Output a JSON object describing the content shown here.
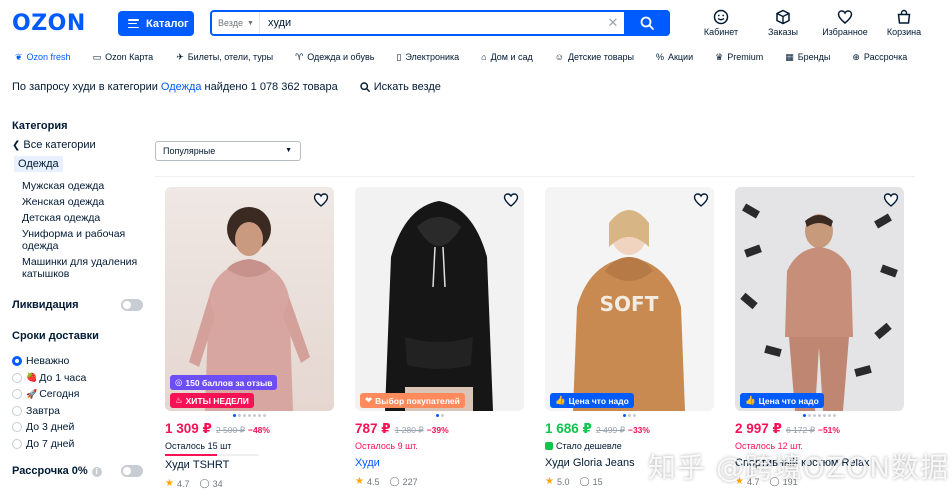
{
  "header": {
    "logo": "OZON",
    "catalog_label": "Каталог",
    "search_scope": "Везде",
    "search_value": "худи",
    "icons": [
      {
        "label": "Кабинет",
        "icon": "smile-icon"
      },
      {
        "label": "Заказы",
        "icon": "box-icon"
      },
      {
        "label": "Избранное",
        "icon": "heart-icon"
      },
      {
        "label": "Корзина",
        "icon": "bag-icon"
      }
    ]
  },
  "nav": [
    {
      "label": "Ozon fresh",
      "icon": "leaf-icon"
    },
    {
      "label": "Ozon Карта",
      "icon": "card-icon"
    },
    {
      "label": "Билеты, отели, туры",
      "icon": "plane-icon"
    },
    {
      "label": "Одежда и обувь",
      "icon": "shirt-icon"
    },
    {
      "label": "Электроника",
      "icon": "phone-icon"
    },
    {
      "label": "Дом и сад",
      "icon": "home-icon"
    },
    {
      "label": "Детские товары",
      "icon": "baby-icon"
    },
    {
      "label": "Акции",
      "icon": "percent-icon"
    },
    {
      "label": "Premium",
      "icon": "crown-icon"
    },
    {
      "label": "Бренды",
      "icon": "brand-icon"
    },
    {
      "label": "Рассрочка",
      "icon": "installment-icon"
    }
  ],
  "query": {
    "prefix": "По запросу худи в категории",
    "category": "Одежда",
    "suffix": "найдено 1 078 362 товара",
    "search_all": "Искать везде"
  },
  "sidebar": {
    "category_title": "Категория",
    "back_label": "Все категории",
    "current": "Одежда",
    "subcategories": [
      "Мужская одежда",
      "Женская одежда",
      "Детская одежда",
      "Униформа и рабочая одежда",
      "Машинки для удаления катышков"
    ],
    "liquidation_label": "Ликвидация",
    "delivery_title": "Сроки доставки",
    "delivery_options": [
      {
        "label": "Неважно",
        "selected": true,
        "emoji": ""
      },
      {
        "label": "До 1 часа",
        "selected": false,
        "emoji": "🍓"
      },
      {
        "label": "Сегодня",
        "selected": false,
        "emoji": "🚀"
      },
      {
        "label": "Завтра",
        "selected": false,
        "emoji": ""
      },
      {
        "label": "До 3 дней",
        "selected": false,
        "emoji": ""
      },
      {
        "label": "До 7 дней",
        "selected": false,
        "emoji": ""
      }
    ],
    "installment_label": "Рассрочка 0%"
  },
  "sort": {
    "selected": "Популярные"
  },
  "products": [
    {
      "price": "1 309 ₽",
      "old_price": "2 500 ₽",
      "discount": "−48%",
      "stock": "Осталось 15 шт",
      "stock_level": 0.55,
      "name": "Худи TSHRT",
      "name_link": false,
      "rating": "4.7",
      "reviews": "34",
      "badges": [
        {
          "text": "150 баллов за отзыв",
          "color": "#6c4df6"
        },
        {
          "text": "ХИТЫ НЕДЕЛИ",
          "color": "#f91155"
        }
      ],
      "note": ""
    },
    {
      "price": "787 ₽",
      "old_price": "1 280 ₽",
      "discount": "−39%",
      "stock": "Осталось 9 шт.",
      "stock_level": 0,
      "name": "Худи",
      "name_link": true,
      "rating": "4.5",
      "reviews": "227",
      "badges": [
        {
          "text": "Выбор покупателей",
          "color": "#ff8a5c"
        }
      ],
      "note": ""
    },
    {
      "price": "1 686 ₽",
      "old_price": "2 499 ₽",
      "discount": "−33%",
      "stock": "",
      "stock_level": 0,
      "name": "Худи Gloria Jeans",
      "name_link": false,
      "rating": "5.0",
      "reviews": "15",
      "badges": [
        {
          "text": "Цена что надо",
          "color": "#005bff"
        }
      ],
      "note": "Стало дешевле"
    },
    {
      "price": "2 997 ₽",
      "old_price": "6 172 ₽",
      "discount": "−51%",
      "stock": "Осталось 12 шт.",
      "stock_level": 0,
      "name": "Спортивный костюм Relax",
      "name_link": false,
      "rating": "4.7",
      "reviews": "191",
      "badges": [
        {
          "text": "Цена что надо",
          "color": "#005bff"
        }
      ],
      "note": ""
    }
  ],
  "watermark": "知乎 @跨境OZON数据",
  "colors": {
    "brand": "#005bff",
    "price_red": "#f91155",
    "price_green": "#10c44c",
    "text": "#001a34"
  }
}
